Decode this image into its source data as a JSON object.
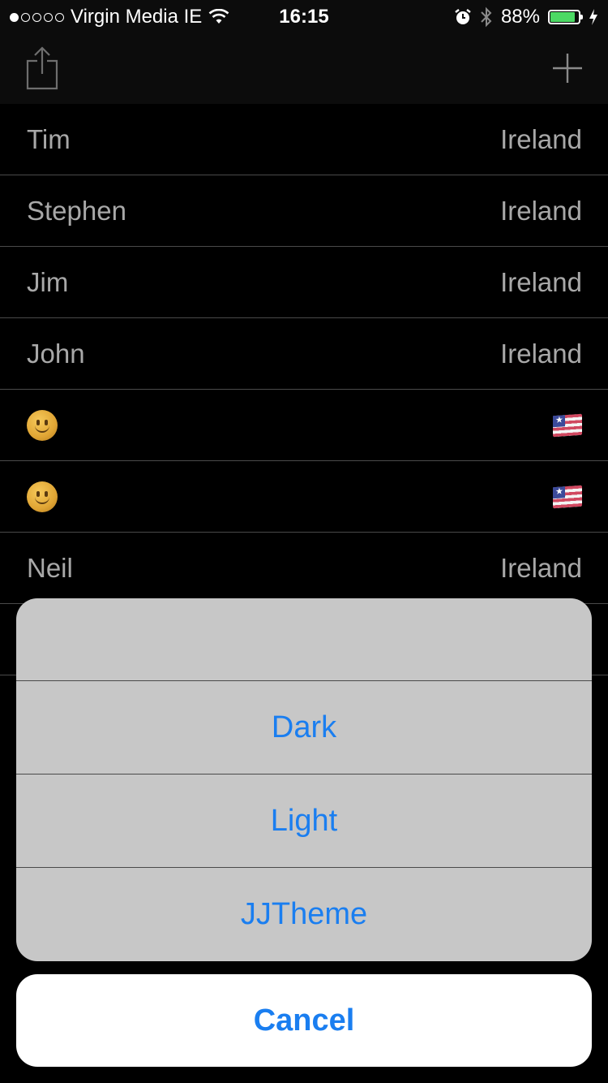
{
  "status_bar": {
    "carrier": "Virgin Media IE",
    "time": "16:15",
    "battery_percent": "88%",
    "battery_level": 0.88,
    "signal_bars_filled": 1,
    "signal_bars_total": 5
  },
  "nav": {
    "left_icon": "share-icon",
    "right_icon": "plus-icon"
  },
  "rows": [
    {
      "name": "Tim",
      "country": "Ireland"
    },
    {
      "name": "Stephen",
      "country": "Ireland"
    },
    {
      "name": "Jim",
      "country": "Ireland"
    },
    {
      "name": "John",
      "country": "Ireland"
    },
    {
      "name": "",
      "country": "",
      "name_icon": "smiley-emoji-icon",
      "country_icon": "flag-emoji-icon"
    },
    {
      "name": "",
      "country": "",
      "name_icon": "smiley-emoji-icon",
      "country_icon": "flag-emoji-icon"
    },
    {
      "name": "Neil",
      "country": "Ireland"
    }
  ],
  "action_sheet": {
    "options": [
      "Dark",
      "Light",
      "JJTheme"
    ],
    "cancel_label": "Cancel"
  },
  "colors": {
    "accent": "#1a7ef0",
    "battery_fill": "#4cd964",
    "row_text": "#a8a8a8",
    "sheet_bg": "#c7c7c7"
  }
}
